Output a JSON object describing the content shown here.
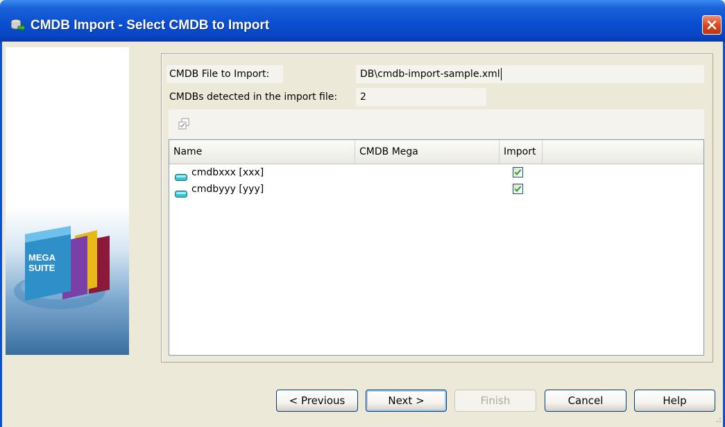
{
  "window": {
    "title": "CMDB Import - Select CMDB to Import",
    "title_icon": "cmdb-app-icon",
    "close_icon": "close-icon"
  },
  "banner": {
    "logo_line1": "MEGA",
    "logo_line2": "SUITE"
  },
  "form": {
    "file_label": "CMDB File to Import:",
    "file_value": "DB\\cmdb-import-sample.xml",
    "detected_label": "CMDBs detected in the import file:",
    "detected_value": "2"
  },
  "toolbar": {
    "icon": "check-all-icon"
  },
  "table": {
    "columns": [
      "Name",
      "CMDB Mega",
      "Import"
    ],
    "rows": [
      {
        "name": "cmdbxxx [xxx]",
        "cmdb_mega": "",
        "import": true
      },
      {
        "name": "cmdbyyy [yyy]",
        "cmdb_mega": "",
        "import": true
      }
    ]
  },
  "buttons": {
    "previous": "< Previous",
    "next": "Next >",
    "finish": "Finish",
    "cancel": "Cancel",
    "help": "Help"
  },
  "colors": {
    "titlebar": "#0a4fd1",
    "window_bg": "#ece9d8",
    "close_button": "#d5451e",
    "checkbox_check": "#21a121"
  }
}
